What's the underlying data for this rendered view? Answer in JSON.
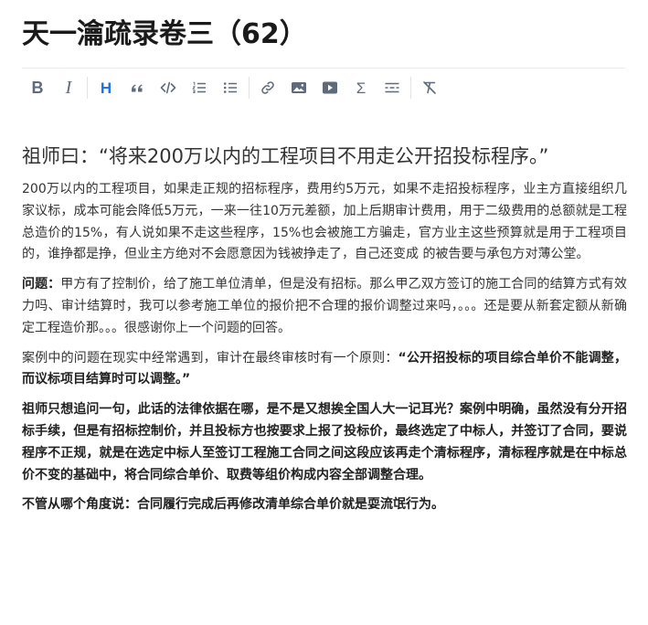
{
  "page": {
    "title": "天一瀹疏录卷三（62）"
  },
  "toolbar": {
    "items": [
      {
        "name": "bold-button",
        "icon": "bold-icon",
        "label": "B"
      },
      {
        "name": "italic-button",
        "icon": "italic-icon",
        "label": "I"
      },
      {
        "name": "heading-button",
        "icon": "heading-icon",
        "label": "H",
        "active": true
      },
      {
        "name": "quote-button",
        "icon": "quote-icon"
      },
      {
        "name": "code-button",
        "icon": "code-icon"
      },
      {
        "name": "ordered-list-button",
        "icon": "ordered-list-icon"
      },
      {
        "name": "bullet-list-button",
        "icon": "bullet-list-icon"
      },
      {
        "name": "link-button",
        "icon": "link-icon"
      },
      {
        "name": "image-button",
        "icon": "image-icon"
      },
      {
        "name": "video-button",
        "icon": "video-icon"
      },
      {
        "name": "formula-button",
        "icon": "sigma-icon",
        "label": "Σ"
      },
      {
        "name": "divider-button",
        "icon": "horizontal-rule-icon"
      },
      {
        "name": "clear-format-button",
        "icon": "clear-format-icon"
      }
    ],
    "active_color": "#1e74e8",
    "icon_color": "#5f6b7a"
  },
  "content": {
    "heading": "祖师曰：“将来200万以内的工程项目不用走公开招投标程序。”",
    "para1": "200万以内的工程项目，如果走正规的招标程序，费用约5万元，如果不走招投标程序，业主方直接组织几家议标，成本可能会降低5万元，一来一往10万元差额，加上后期审计费用，用于二级费用的总额就是工程总造价的15%，有人说如果不走这些程序，15%也会被施工方骗走，官方业主这些预算就是用于工程项目的，谁挣都是挣，但业主方绝对不会愿意因为钱被挣走了，自己还变成 的被告要与承包方对薄公堂。",
    "para2_label": "问题：",
    "para2_text": "甲方有了控制价，给了施工单位清单，但是没有招标。那么甲乙双方签订的施工合同的结算方式有效力吗、审计结算时，我可以参考施工单位的报价把不合理的报价调整过来吗，。。。还是要从新套定额从新确定工程造价那。。。很感谢你上一个问题的回答。",
    "para3_text": "案例中的问题在现实中经常遇到，审计在最终审核时有一个原则：",
    "para3_bold": "“公开招投标的项目综合单价不能调整，而议标项目结算时可以调整。”",
    "para4_bold": "祖师只想追问一句，此话的法律依据在哪，是不是又想挨全国人大一记耳光？案例中明确，虽然没有分开招标手续，但是有招标控制价，并且投标方也按要求上报了投标价，最终选定了中标人，并签订了合同，要说程序不正规，就是在选定中标人至签订工程施工合同之间这段应该再走个清标程序，清标程序就是在中标总价不变的基础中，将合同综合单价、取费等组价构成内容全部调整合理。",
    "para5_bold": "不管从哪个角度说：合同履行完成后再修改清单综合单价就是耍流氓行为。"
  }
}
